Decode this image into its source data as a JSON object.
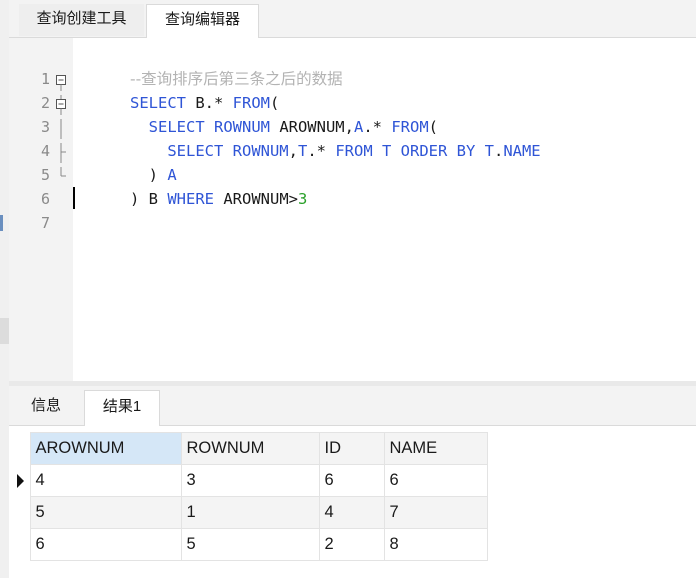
{
  "tabs": {
    "query_builder": "查询创建工具",
    "query_editor": "查询编辑器"
  },
  "editor": {
    "lines": [
      {
        "n": "1",
        "segs": [
          {
            "t": "--查询排序后第三条之后的数据",
            "c": "cmt"
          }
        ]
      },
      {
        "n": "2",
        "segs": [
          {
            "t": "SELECT",
            "c": "kw"
          },
          {
            "t": " B.* ",
            "c": "id"
          },
          {
            "t": "FROM",
            "c": "kw"
          },
          {
            "t": "(",
            "c": "id"
          }
        ]
      },
      {
        "n": "3",
        "segs": [
          {
            "t": "  SELECT ROWNUM",
            "c": "kw"
          },
          {
            "t": " AROWNUM,",
            "c": "id"
          },
          {
            "t": "A",
            "c": "kw"
          },
          {
            "t": ".* ",
            "c": "id"
          },
          {
            "t": "FROM",
            "c": "kw"
          },
          {
            "t": "(",
            "c": "id"
          }
        ]
      },
      {
        "n": "4",
        "segs": [
          {
            "t": "    SELECT ROWNUM",
            "c": "kw"
          },
          {
            "t": ",",
            "c": "id"
          },
          {
            "t": "T",
            "c": "kw"
          },
          {
            "t": ".* ",
            "c": "id"
          },
          {
            "t": "FROM T ORDER BY T",
            "c": "kw"
          },
          {
            "t": ".",
            "c": "id"
          },
          {
            "t": "NAME",
            "c": "kw"
          }
        ]
      },
      {
        "n": "5",
        "segs": [
          {
            "t": "  ) ",
            "c": "id"
          },
          {
            "t": "A",
            "c": "kw"
          }
        ]
      },
      {
        "n": "6",
        "segs": [
          {
            "t": ") B ",
            "c": "id"
          },
          {
            "t": "WHERE",
            "c": "kw"
          },
          {
            "t": " AROWNUM>",
            "c": "id"
          },
          {
            "t": "3",
            "c": "num"
          }
        ]
      },
      {
        "n": "7",
        "segs": []
      }
    ]
  },
  "bottom_tabs": {
    "info": "信息",
    "result1": "结果1"
  },
  "result": {
    "columns": [
      "AROWNUM",
      "ROWNUM",
      "ID",
      "NAME"
    ],
    "rows": [
      [
        "4",
        "3",
        "6",
        "6"
      ],
      [
        "5",
        "1",
        "4",
        "7"
      ],
      [
        "6",
        "5",
        "2",
        "8"
      ]
    ]
  },
  "colors": {
    "keyword": "#2f55d6",
    "number": "#2aa02a",
    "comment": "#b3b3b3",
    "selected_header": "#d5e7f7"
  }
}
